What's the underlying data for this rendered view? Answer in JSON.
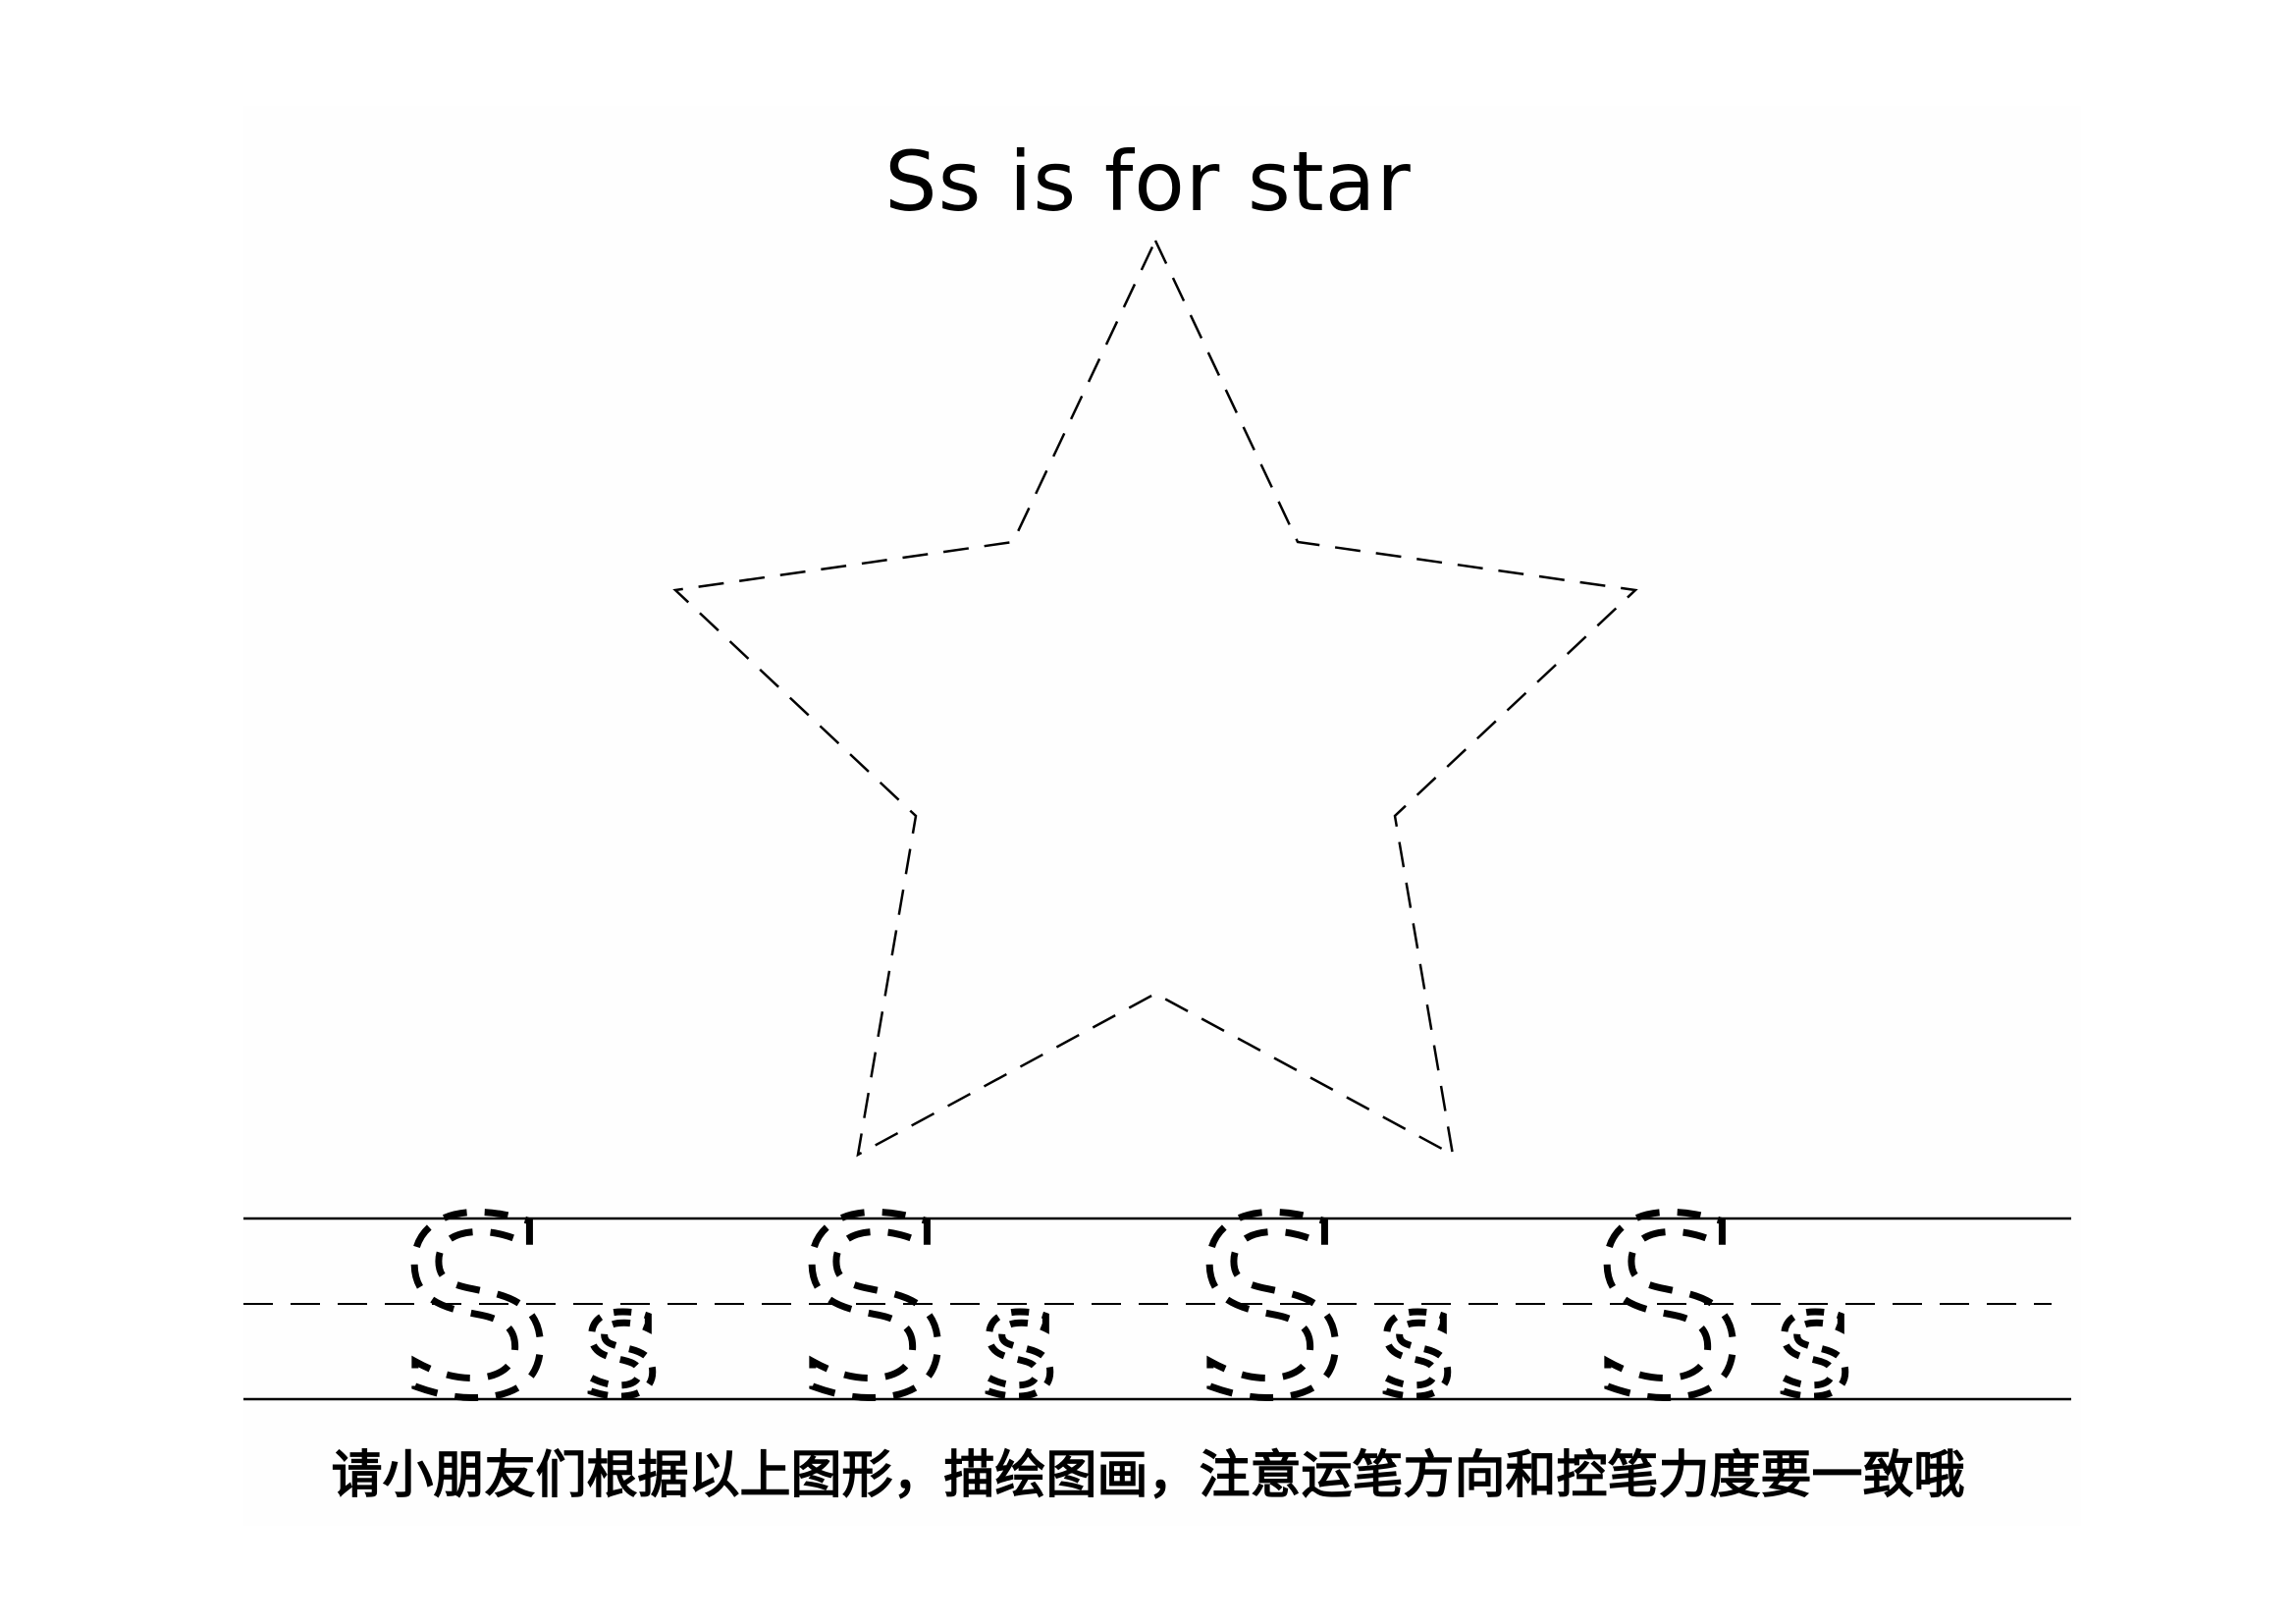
{
  "worksheet": {
    "title": "Ss is for star",
    "instruction": "请小朋友们根据以上图形，描绘图画，注意运笔方向和控笔力度要一致哦"
  },
  "tracing_row": {
    "pairs": [
      {
        "upper": "S",
        "lower": "s"
      },
      {
        "upper": "S",
        "lower": "s"
      },
      {
        "upper": "S",
        "lower": "s"
      },
      {
        "upper": "S",
        "lower": "s"
      }
    ]
  },
  "colors": {
    "ink": "#000000",
    "paper": "#fefefe"
  }
}
